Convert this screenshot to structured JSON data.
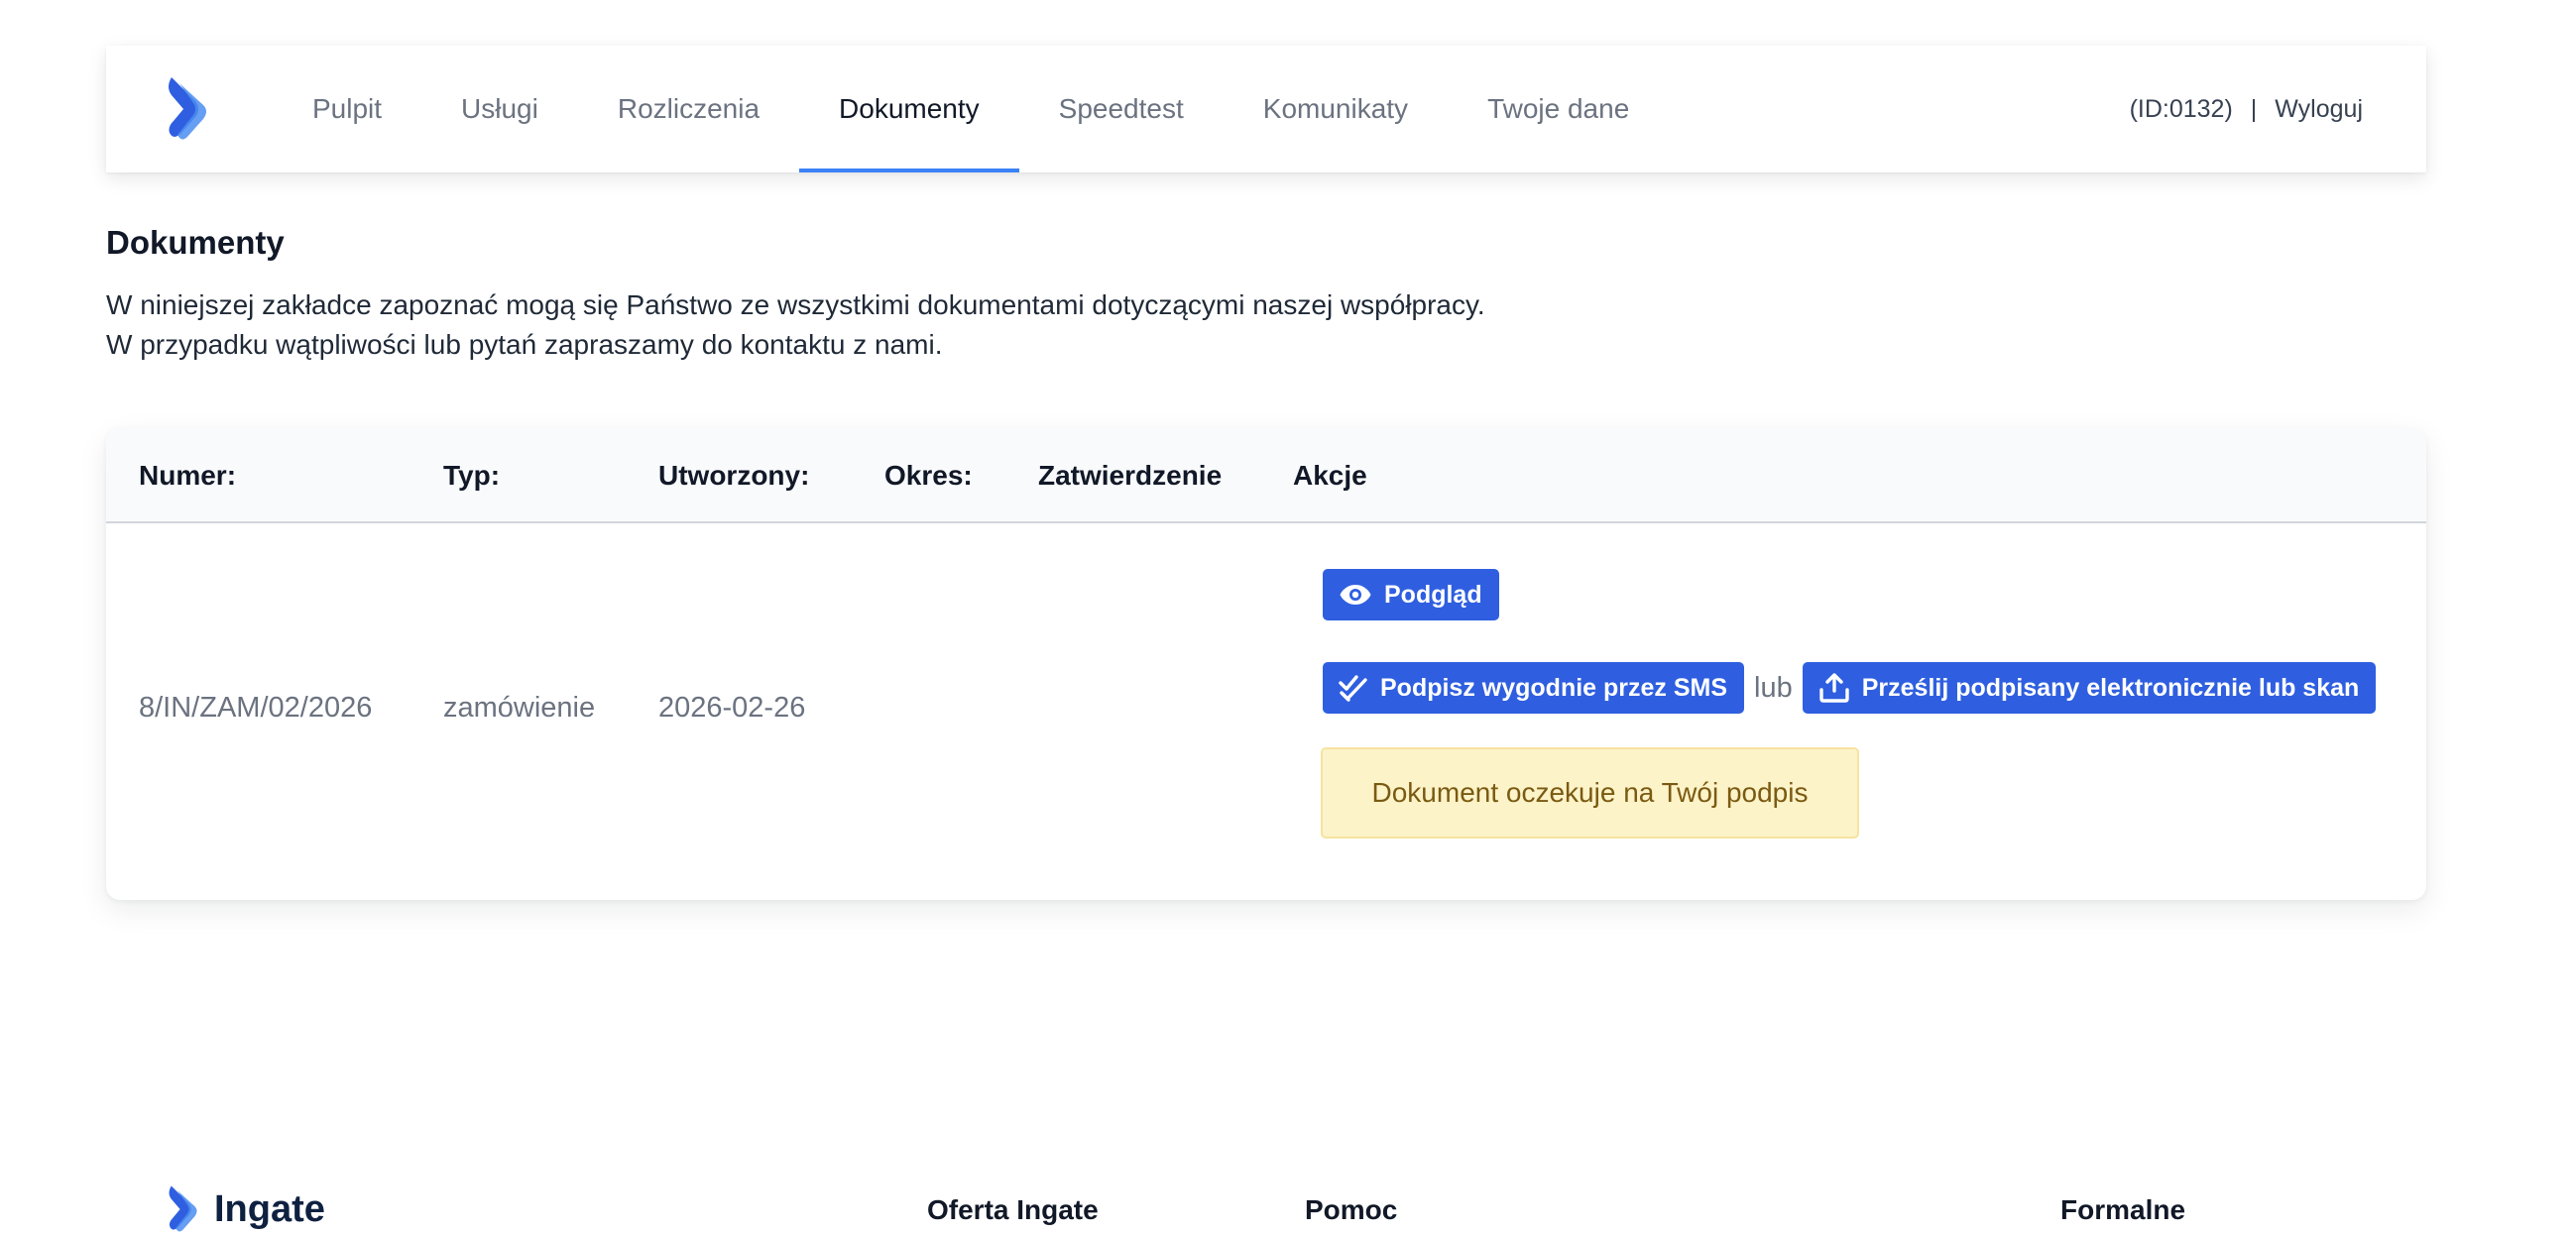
{
  "nav": {
    "items": [
      {
        "label": "Pulpit",
        "active": false
      },
      {
        "label": "Usługi",
        "active": false
      },
      {
        "label": "Rozliczenia",
        "active": false
      },
      {
        "label": "Dokumenty",
        "active": true
      },
      {
        "label": "Speedtest",
        "active": false
      },
      {
        "label": "Komunikaty",
        "active": false
      },
      {
        "label": "Twoje dane",
        "active": false
      }
    ],
    "user_id": "(ID:0132)",
    "separator": "|",
    "logout_label": "Wyloguj",
    "accent_color": "#3b82f6",
    "logo_icon": "chevron-right-logo"
  },
  "page": {
    "title": "Dokumenty",
    "intro_line_1": "W niniejszej zakładce zapoznać mogą się Państwo ze wszystkimi dokumentami dotyczącymi naszej współpracy.",
    "intro_line_2": "W przypadku wątpliwości lub pytań zapraszamy do kontaktu z nami."
  },
  "table": {
    "headers": {
      "numer": "Numer:",
      "typ": "Typ:",
      "utworzony": "Utworzony:",
      "okres": "Okres:",
      "zatwierdzenie": "Zatwierdzenie",
      "akcje": "Akcje"
    },
    "rows": [
      {
        "numer": "8/IN/ZAM/02/2026",
        "typ": "zamówienie",
        "utworzony": "2026-02-26",
        "okres": "",
        "zatwierdzenie": "",
        "actions": {
          "preview_label": "Podgląd",
          "preview_icon": "eye-icon",
          "sms_sign_label": "Podpisz wygodnie przez SMS",
          "sms_sign_icon": "double-check-icon",
          "or_label": "lub",
          "upload_label": "Prześlij podpisany elektronicznie lub skan",
          "upload_icon": "upload-icon",
          "status_text": "Dokument oczekuje na Twój podpis"
        }
      }
    ],
    "button_color": "#2f5fe0",
    "status_bg_color": "#fdf3c8"
  },
  "footer": {
    "brand": "Ingate",
    "columns": [
      "Oferta Ingate",
      "Pomoc",
      "Formalne"
    ]
  }
}
